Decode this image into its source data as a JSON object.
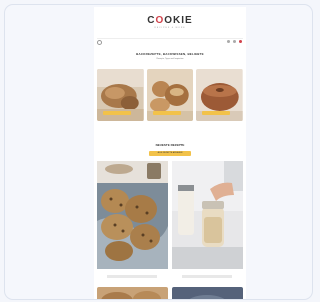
{
  "site": {
    "logo_prefix": "C",
    "logo_o": "O",
    "logo_suffix": "OKIE",
    "tagline": "RECIPES & MORE"
  },
  "hero": {
    "title": "BACKREZEPTE, BACKWISSEN, BELIEBTE",
    "subtitle": "Rezepte, Tipps und Inspiration",
    "items": [
      {
        "label": "Brot backen",
        "button": ""
      },
      {
        "label": "Kuchen",
        "button": ""
      },
      {
        "label": "Gugelhupf",
        "button": ""
      }
    ]
  },
  "section": {
    "title": "NEUESTE REZEPTE",
    "button": "ALLE REZEPTE ANSEHEN"
  },
  "featured": [
    {
      "caption": ""
    },
    {
      "caption": ""
    }
  ],
  "colors": {
    "accent": "#f2c24a",
    "brand": "#d1424b"
  }
}
